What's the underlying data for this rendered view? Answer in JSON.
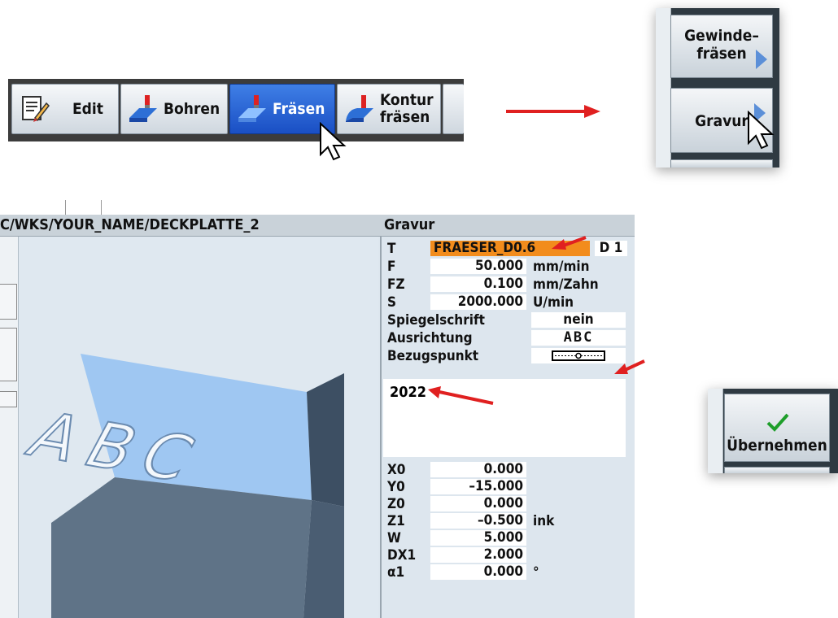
{
  "toolbar": {
    "items": [
      {
        "label": "Edit",
        "icon": "edit-icon"
      },
      {
        "label": "Bohren",
        "icon": "drill-icon"
      },
      {
        "label": "Fräsen",
        "icon": "mill-icon",
        "active": true
      },
      {
        "label_line1": "Kontur",
        "label_line2": "fräsen",
        "icon": "contour-mill-icon"
      }
    ]
  },
  "softkeys": {
    "thread_mill_line1": "Gewinde–",
    "thread_mill_line2": "fräsen",
    "engrave": "Gravur"
  },
  "header": {
    "path": "C/WKS/YOUR_NAME/DECKPLATTE_2",
    "title": "Gravur"
  },
  "viewport": {
    "engraved_text": "ABC"
  },
  "params": {
    "tool": {
      "label": "T",
      "value": "FRAESER_D0.6",
      "d_label": "D 1"
    },
    "feed": {
      "label": "F",
      "value": "50.000",
      "unit": "mm/min"
    },
    "fz": {
      "label": "FZ",
      "value": "0.100",
      "unit": "mm/Zahn"
    },
    "speed": {
      "label": "S",
      "value": "2000.000",
      "unit": "U/min"
    },
    "mirror": {
      "label": "Spiegelschrift",
      "value": "nein"
    },
    "alignment": {
      "label": "Ausrichtung",
      "value": "ABC"
    },
    "reference": {
      "label": "Bezugspunkt"
    },
    "text": "2022",
    "x0": {
      "label": "X0",
      "value": "0.000"
    },
    "y0": {
      "label": "Y0",
      "value": "–15.000"
    },
    "z0": {
      "label": "Z0",
      "value": "0.000"
    },
    "z1": {
      "label": "Z1",
      "value": "–0.500",
      "unit": "ink"
    },
    "w": {
      "label": "W",
      "value": "5.000"
    },
    "dx1": {
      "label": "DX1",
      "value": "2.000"
    },
    "alpha1": {
      "label": "α1",
      "value": "0.000",
      "unit": "°"
    }
  },
  "confirm": {
    "label": "Übernehmen",
    "icon": "checkmark-icon"
  },
  "colors": {
    "active_button": "#2a62d6",
    "tool_highlight": "#f28c1c",
    "annotation_arrow": "#e02020"
  }
}
